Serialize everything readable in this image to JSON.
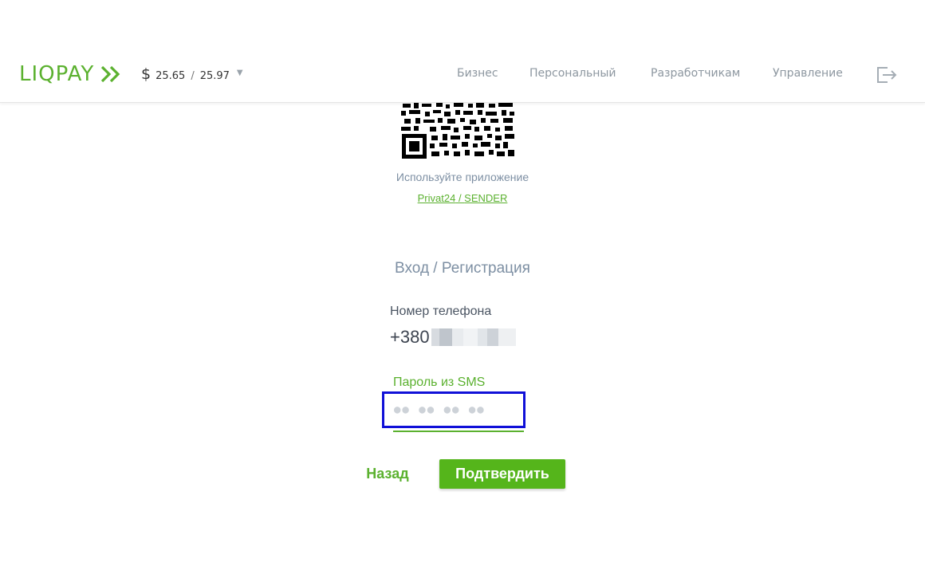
{
  "header": {
    "logo_text": "LIQPAY",
    "rate": {
      "currency_symbol": "$",
      "buy": "25.65",
      "separator": "/",
      "sell": "25.97"
    },
    "nav": {
      "business": "Бизнес",
      "personal": "Персональный",
      "developers": "Разработчикам",
      "management": "Управление"
    }
  },
  "qr": {
    "hint": "Используйте приложение",
    "app1": "Privat24",
    "app_sep": " / ",
    "app2": "SENDER"
  },
  "login": {
    "title": "Вход / Регистрация",
    "phone_label": "Номер телефона",
    "phone_prefix": "+380",
    "sms_label": "Пароль из SMS",
    "sms_placeholder": "●● ●● ●● ●●",
    "back_label": "Назад",
    "confirm_label": "Подтвердить"
  },
  "colors": {
    "brand_green": "#5bb12f",
    "button_green": "#55b51b",
    "focus_outline": "#1010d8",
    "muted_text": "#7d8fa3"
  }
}
